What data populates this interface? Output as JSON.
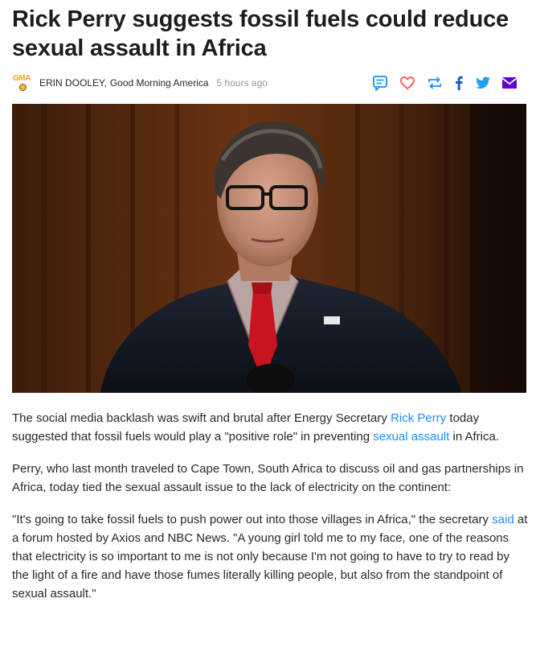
{
  "headline": "Rick Perry suggests fossil fuels could reduce sexual assault in Africa",
  "byline": {
    "logo_text": "GMA",
    "author": "ERIN DOOLEY,",
    "source": "Good Morning America",
    "timestamp": "5 hours ago"
  },
  "share": {
    "icons": [
      "comment-icon",
      "heart-icon",
      "retweet-icon",
      "facebook-icon",
      "twitter-icon",
      "mail-icon"
    ],
    "colors": {
      "comment": "#188fff",
      "heart": "#ff4d52",
      "retweet": "#188fff",
      "facebook": "#1a5bd1",
      "twitter": "#1da1f2",
      "mail": "#6001d2"
    }
  },
  "hero_image": {
    "icon": "news-photo"
  },
  "article": {
    "p1": {
      "t1": "The social media backlash was swift and brutal after Energy Secretary ",
      "link1": "Rick Perry",
      "t2": " today suggested that fossil fuels would play a \"positive role\" in preventing ",
      "link2": "sexual assault",
      "t3": " in Africa."
    },
    "p2": {
      "text": "Perry, who last month traveled to Cape Town, South Africa to discuss oil and gas partnerships in Africa, today tied the sexual assault issue to the lack of electricity on the continent:"
    },
    "p3": {
      "t1": "\"It's going to take fossil fuels to push power out into those villages in Africa,\" the secretary ",
      "link1": "said",
      "t2": " at a forum hosted by Axios and NBC News. \"A young girl told me to my face, one of the reasons that electricity is so important to me is not only because I'm not going to have to try to read by the light of a fire and have those fumes literally killing people, but also from the standpoint of sexual assault.\""
    }
  },
  "colors": {
    "link": "#188fff",
    "text": "#26282a",
    "timestamp": "#959595"
  }
}
